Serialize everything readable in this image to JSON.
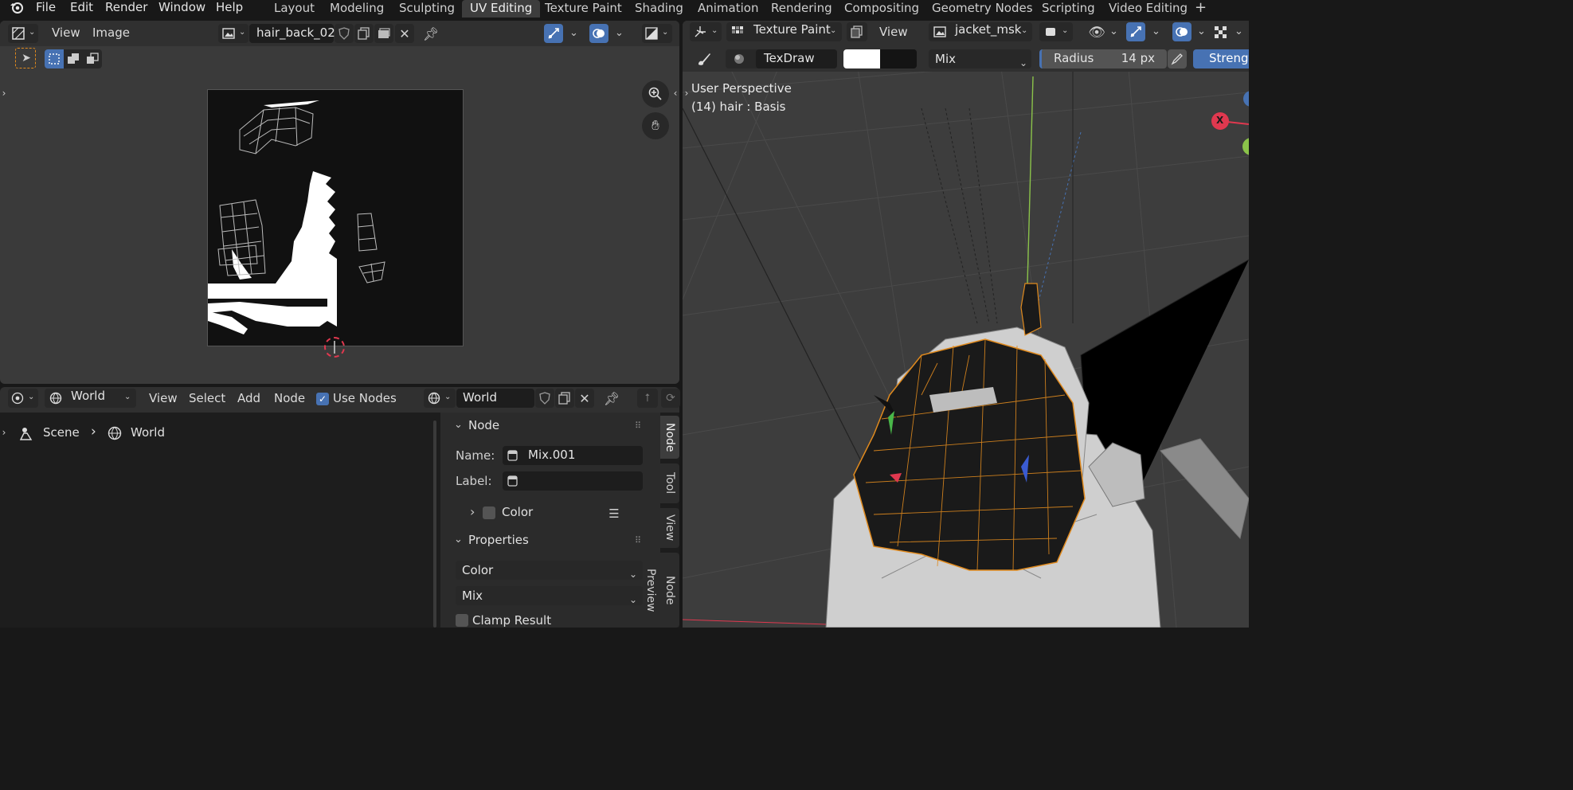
{
  "topbar": {
    "menus": [
      "File",
      "Edit",
      "Render",
      "Window",
      "Help"
    ],
    "workspaces": [
      "Layout",
      "Modeling",
      "Sculpting",
      "UV Editing",
      "Texture Paint",
      "Shading",
      "Animation",
      "Rendering",
      "Compositing",
      "Geometry Nodes",
      "Scripting",
      "Video Editing"
    ],
    "active_workspace": "UV Editing",
    "add_tab": "+"
  },
  "uv_editor": {
    "menu_view": "View",
    "menu_image": "Image",
    "image_name": "hair_back_02"
  },
  "viewport": {
    "mode": "Texture Paint",
    "menu_view": "View",
    "texture_slot": "jacket_msk",
    "brush_name": "TexDraw",
    "blend_mode": "Mix",
    "radius_label": "Radius",
    "radius_value": "14 px",
    "strength_label": "Strength",
    "overlay_title": "User Perspective",
    "overlay_object": "(14) hair : Basis",
    "gizmo_x": "X"
  },
  "node_editor": {
    "world_type": "World",
    "menu_view": "View",
    "menu_select": "Select",
    "menu_add": "Add",
    "menu_node": "Node",
    "use_nodes_label": "Use Nodes",
    "world_name": "World",
    "breadcrumb_scene": "Scene",
    "breadcrumb_world": "World"
  },
  "sidebar": {
    "node_header": "Node",
    "name_label": "Name:",
    "name_value": "Mix.001",
    "label_label": "Label:",
    "label_value": "",
    "color_label": "Color",
    "properties_header": "Properties",
    "data_type": "Color",
    "blend_type": "Mix",
    "clamp_label": "Clamp Result",
    "tabs": [
      "Node",
      "Tool",
      "View",
      "Node Preview"
    ]
  },
  "colors": {
    "accent": "#4772b3",
    "active_edge": "#e08a1e",
    "axis_x": "#e0384f",
    "axis_y": "#8bc34a"
  }
}
